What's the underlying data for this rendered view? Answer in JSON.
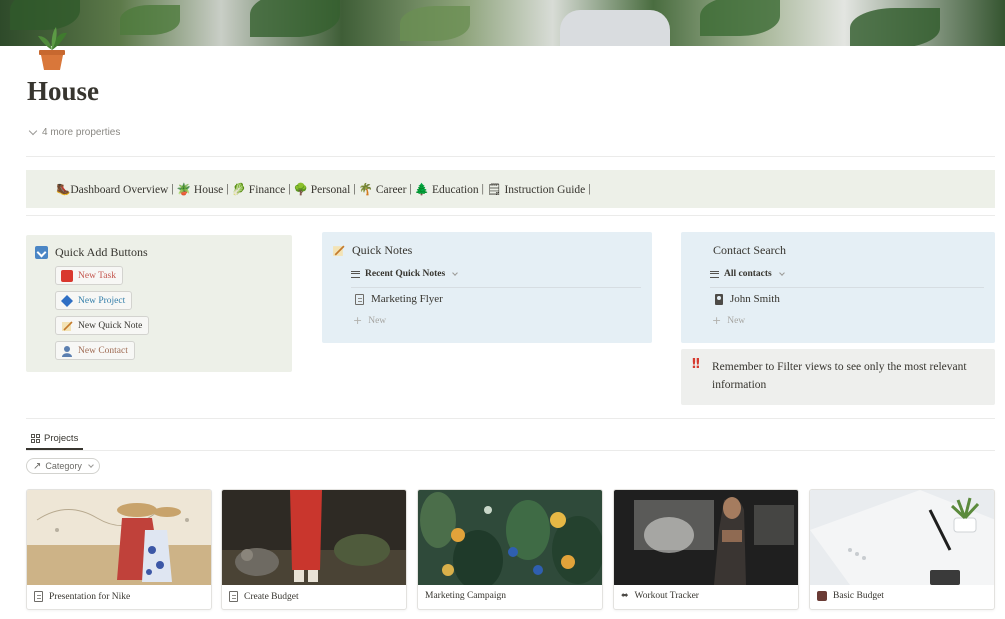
{
  "page": {
    "title": "House",
    "properties_toggle": "4 more properties"
  },
  "nav": {
    "items": [
      {
        "emoji": "🥾",
        "label": "Dashboard Overview"
      },
      {
        "emoji": "🪴",
        "label": "House"
      },
      {
        "emoji": "🥬",
        "label": "Finance"
      },
      {
        "emoji": "🌳",
        "label": "Personal"
      },
      {
        "emoji": "🌴",
        "label": "Career"
      },
      {
        "emoji": "🌲",
        "label": "Education"
      },
      {
        "emoji": "🗒",
        "label": "Instruction Guide"
      }
    ],
    "separator": "|"
  },
  "quick_add": {
    "title": "Quick Add Buttons",
    "buttons": [
      {
        "label": "New Task",
        "icon": "red-square-icon",
        "color": "#c4554d"
      },
      {
        "label": "New Project",
        "icon": "blue-diamond-icon",
        "color": "#337ea9"
      },
      {
        "label": "New Quick Note",
        "icon": "memo-icon",
        "color": "#37352f"
      },
      {
        "label": "New Contact",
        "icon": "person-icon",
        "color": "#9f6b53"
      }
    ]
  },
  "quick_notes": {
    "title": "Quick Notes",
    "view": "Recent Quick Notes",
    "items": [
      "Marketing Flyer"
    ],
    "new_label": "New"
  },
  "contact_search": {
    "title": "Contact Search",
    "view": "All contacts",
    "items": [
      "John Smith"
    ],
    "new_label": "New"
  },
  "reminder": {
    "icon": "double-exclamation-icon",
    "text": "Remember to Filter views to see only the most relevant information"
  },
  "projects": {
    "tab": "Projects",
    "filter": "Category",
    "cards": [
      {
        "title": "Presentation for Nike",
        "icon": "document-icon"
      },
      {
        "title": "Create Budget",
        "icon": "document-icon"
      },
      {
        "title": "Marketing Campaign",
        "icon": ""
      },
      {
        "title": "Workout Tracker",
        "icon": "dumbbell-icon"
      },
      {
        "title": "Basic Budget",
        "icon": "bag-icon"
      }
    ]
  },
  "colors": {
    "nav_bg": "#edf0e8",
    "callout_blue": "#e5eff5",
    "callout_gray": "#eeefed",
    "text": "#37352f"
  }
}
